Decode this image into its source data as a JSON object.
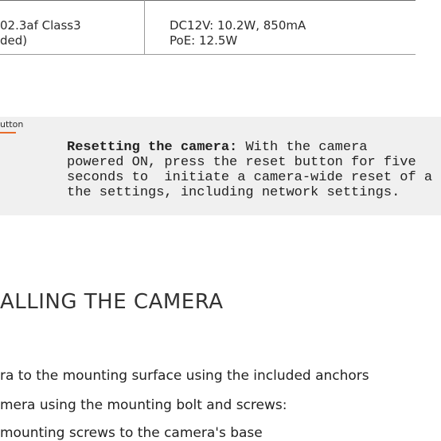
{
  "spec_table": {
    "left_cell_line1": "02.3af Class3",
    "left_cell_line2": "ded)",
    "right_cell_line1": "DC12V: 10.2W, 850mA",
    "right_cell_line2": "PoE: 12.5W"
  },
  "note": {
    "label": "utton",
    "title": "Resetting the camera:",
    "line1": " With the camera",
    "line2": "powered ON, press the reset button for five",
    "line3": "seconds to  initiate a camera-wide reset of a",
    "line4": "the settings, including network settings.",
    "accent_color": "#e86c2a"
  },
  "section": {
    "heading": "ALLING THE CAMERA"
  },
  "steps": [
    "ra to the mounting surface using the included anchors",
    "mera using the mounting bolt and screws:",
    "mounting screws to the camera's base"
  ]
}
